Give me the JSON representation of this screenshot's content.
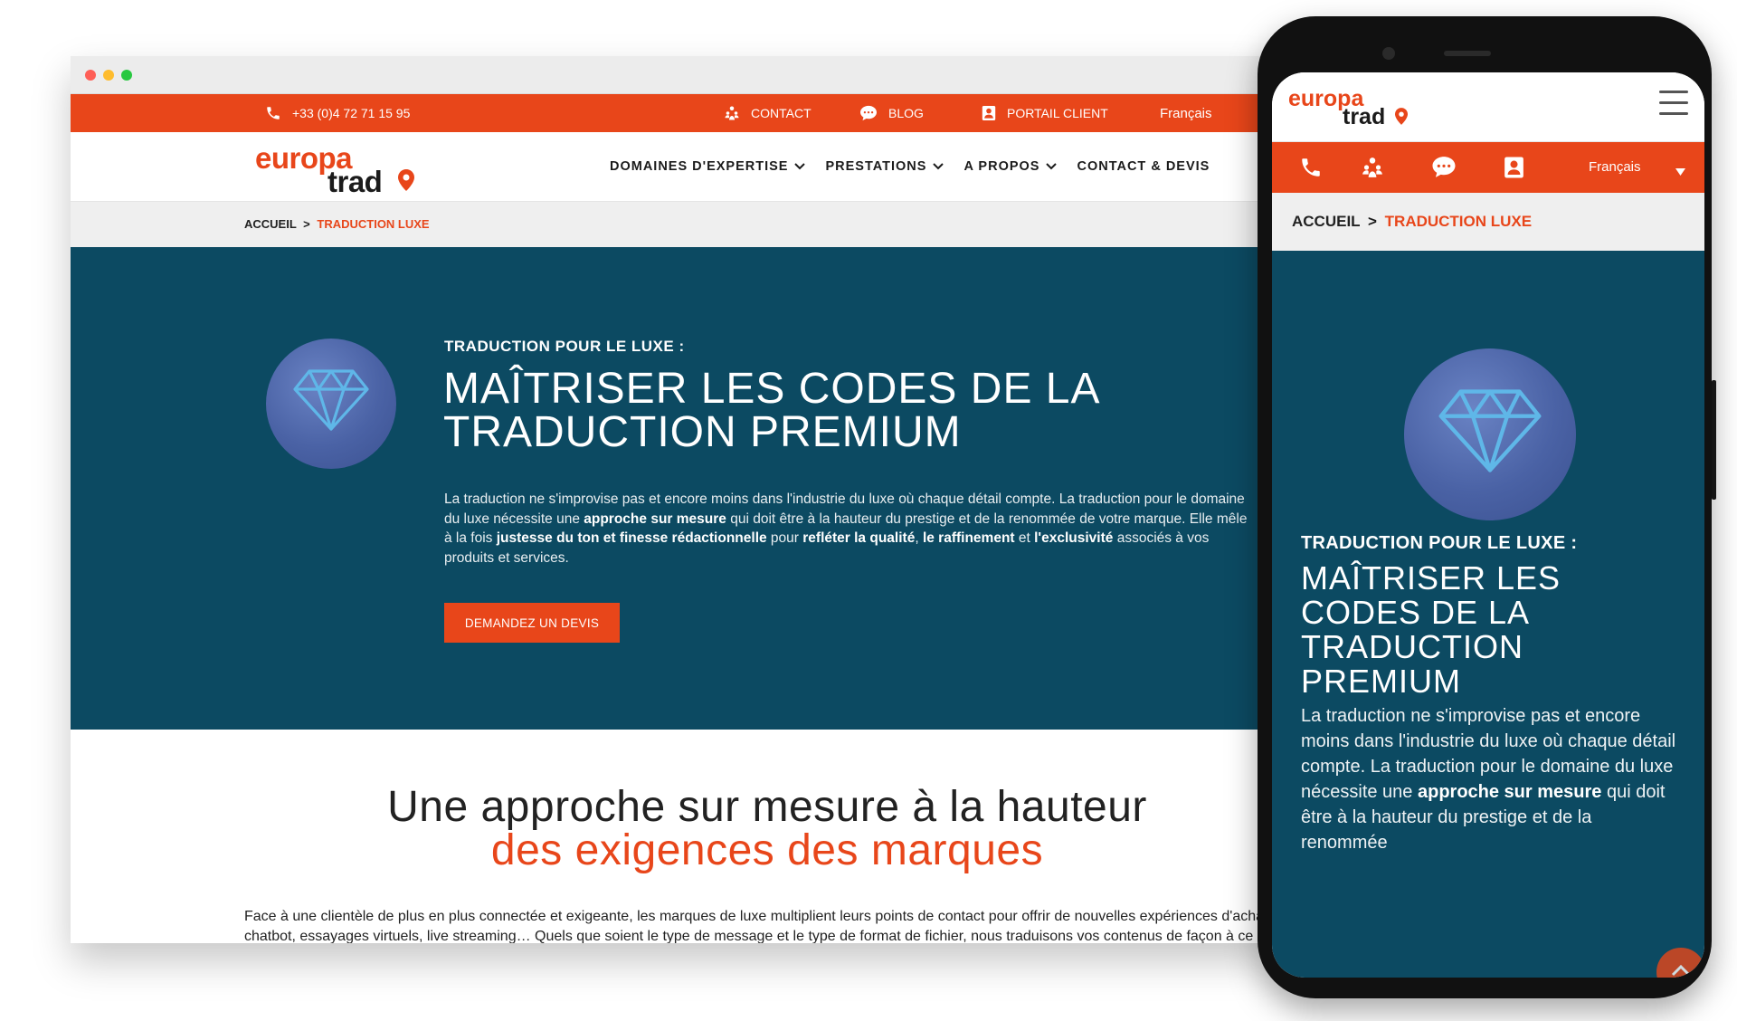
{
  "desktop": {
    "topbar": {
      "phone": "+33 (0)4 72 71 15 95",
      "contact": "CONTACT",
      "blog": "BLOG",
      "portal": "PORTAIL CLIENT",
      "language": "Français"
    },
    "logo": {
      "line1": "europa",
      "line2": "trad"
    },
    "nav": [
      {
        "label": "DOMAINES D'EXPERTISE",
        "has_dropdown": true
      },
      {
        "label": "PRESTATIONS",
        "has_dropdown": true
      },
      {
        "label": "A PROPOS",
        "has_dropdown": true
      },
      {
        "label": "CONTACT & DEVIS",
        "has_dropdown": false
      }
    ],
    "breadcrumb": {
      "home": "ACCUEIL",
      "separator": ">",
      "current": "TRADUCTION LUXE"
    },
    "hero": {
      "kicker": "TRADUCTION POUR LE LUXE :",
      "title_line1": "MAÎTRISER LES CODES DE LA",
      "title_line2": "TRADUCTION PREMIUM",
      "text_parts": [
        "La traduction ne s'improvise pas et encore moins dans l'industrie du luxe où chaque détail compte. La traduction pour le domaine du luxe nécessite une ",
        "approche sur mesure",
        " qui doit être à la hauteur du prestige et de la renommée de votre marque. Elle mêle à la fois ",
        "justesse du ton et finesse rédactionnelle",
        " pour ",
        "refléter la qualité",
        ", ",
        "le raffinement",
        " et ",
        "l'exclusivité",
        " associés à vos produits et services."
      ],
      "cta": "DEMANDEZ UN DEVIS"
    },
    "section2": {
      "heading_line1": "Une approche sur mesure à la hauteur",
      "heading_line2": "des exigences des marques",
      "body": "Face à une clientèle de plus en plus connectée et exigeante, les marques de luxe multiplient leurs points de contact pour offrir de nouvelles expériences d'achat : chatbot, essayages virtuels, live streaming… Quels que soient le type de message et le type de format de fichier, nous traduisons vos contenus de façon à ce qu'ils reflètent fidèlement l'identité de votre marque."
    }
  },
  "mobile": {
    "logo": {
      "line1": "europa",
      "line2": "trad"
    },
    "language": "Français",
    "breadcrumb": {
      "home": "ACCUEIL",
      "separator": ">",
      "current": "TRADUCTION LUXE"
    },
    "hero": {
      "kicker": "TRADUCTION POUR LE LUXE :",
      "title_lines": [
        "MAÎTRISER LES",
        "CODES DE LA",
        "TRADUCTION",
        "PREMIUM"
      ],
      "text_parts": [
        "La traduction ne s'improvise pas et encore moins dans l'industrie du luxe où chaque détail compte. La traduction pour le domaine du luxe nécessite une ",
        "approche sur mesure",
        " qui doit être à la hauteur du prestige et de la renommée"
      ]
    }
  },
  "colors": {
    "accent": "#e8461a",
    "hero_bg": "#0c4a62",
    "gem": "#4a62a5"
  },
  "icons": [
    "phone-icon",
    "contact-people-icon",
    "chat-bubble-icon",
    "portal-user-icon",
    "chevron-down-icon",
    "diamond-icon",
    "hamburger-menu-icon",
    "scroll-top-icon"
  ]
}
